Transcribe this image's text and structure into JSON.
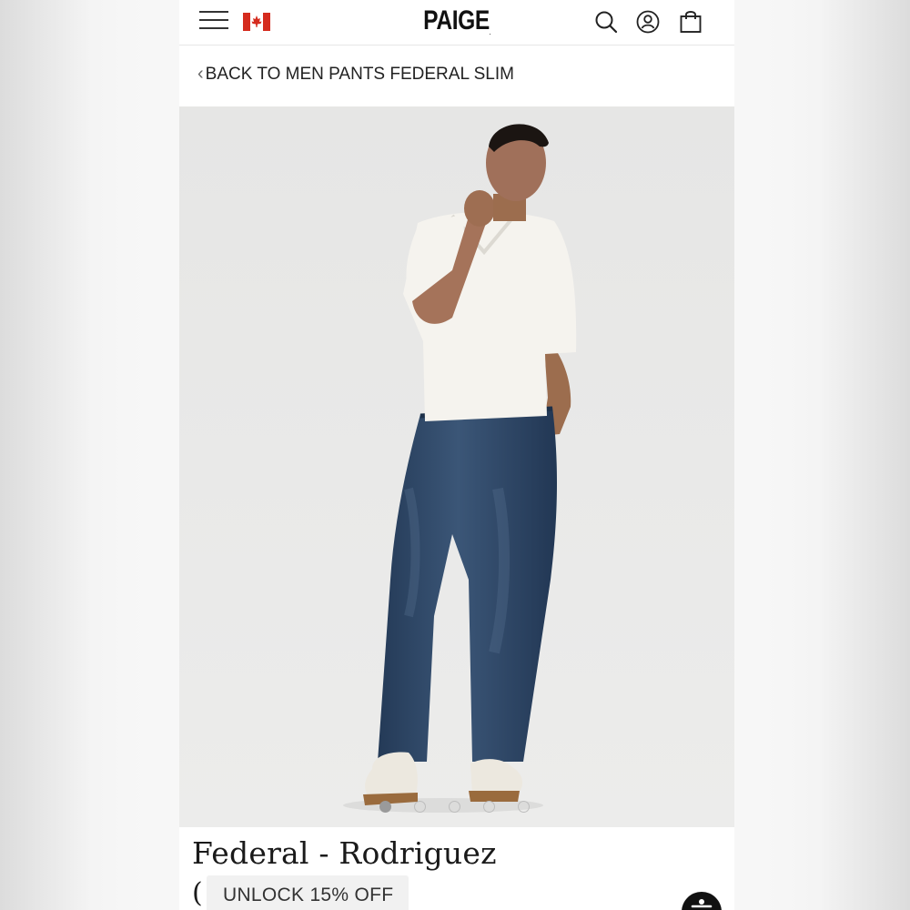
{
  "header": {
    "logo": "PAIGE",
    "logo_mark": "."
  },
  "breadcrumb": {
    "chevron": "‹",
    "label": "BACK TO MEN PANTS FEDERAL SLIM"
  },
  "gallery": {
    "slides": 5,
    "active_slide": 1
  },
  "product": {
    "title": "Federal - Rodriguez",
    "price_prefix": "("
  },
  "promo": {
    "label": "UNLOCK 15% OFF"
  },
  "icons": {
    "menu": "menu-icon",
    "flag": "canada-flag-icon",
    "search": "search-icon",
    "account": "account-icon",
    "bag": "shopping-bag-icon",
    "accessibility": "accessibility-icon"
  },
  "colors": {
    "flag_red": "#d52b1e",
    "hero_bg": "#e9e9e8",
    "denim": "#2f4663"
  }
}
